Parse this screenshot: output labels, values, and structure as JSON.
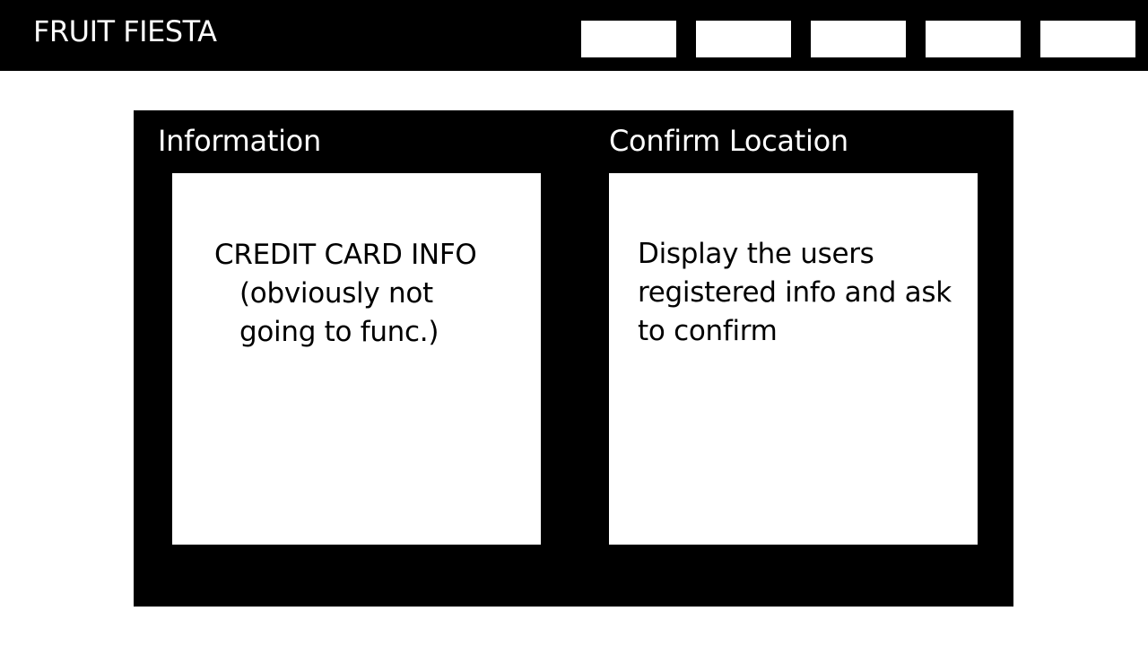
{
  "header": {
    "title": "FRUIT FIESTA",
    "nav_buttons": [
      "",
      "",
      "",
      "",
      ""
    ]
  },
  "main": {
    "information": {
      "title": "Information",
      "card_lines": [
        "CREDIT CARD INFO",
        "(obviously not",
        "going to func.)"
      ]
    },
    "confirm_location": {
      "title": "Confirm Location",
      "card_lines": [
        "Display the users",
        "registered info and ask",
        "to confirm"
      ]
    }
  },
  "colors": {
    "background": "#ffffff",
    "panel": "#000000",
    "text_light": "#ffffff",
    "text_dark": "#000000"
  }
}
